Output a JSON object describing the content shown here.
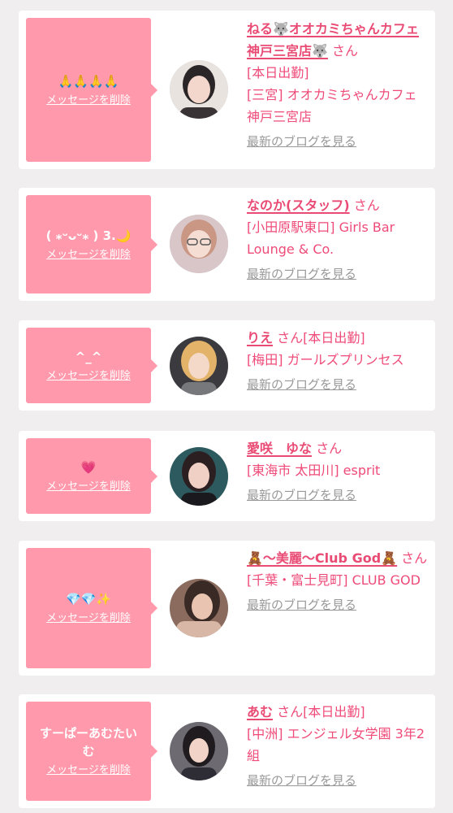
{
  "colors": {
    "page_bg": "#f1eeef",
    "card_bg": "#ffffff",
    "bubble_bg": "#ff99ab",
    "accent_pink": "#e94b74",
    "link_gray": "#999999"
  },
  "entries": [
    {
      "message": "🙏🙏🙏🙏",
      "delete_label": "メッセージを削除",
      "name": "ねる🐺オオカミちゃんカフェ神戸三宮店🐺",
      "honorific": " さん",
      "status": "[本日出勤]",
      "location": "[三宮] オオカミちゃんカフェ神戸三宮店",
      "blog_label": "最新のブログを見る",
      "avatar_icon": "profile-photo"
    },
    {
      "message": "( ⁎ᵕᴗᵕ⁎ ) 3.🌙",
      "delete_label": "メッセージを削除",
      "name": "なのか(スタッフ)",
      "honorific": " さん",
      "status": "",
      "location": "[小田原駅東口] Girls Bar Lounge & Co.",
      "blog_label": "最新のブログを見る",
      "avatar_icon": "profile-photo"
    },
    {
      "message": "^_^",
      "delete_label": "メッセージを削除",
      "name": "りえ",
      "honorific": " さん[本日出勤]",
      "status": "",
      "location": "[梅田] ガールズプリンセス",
      "blog_label": "最新のブログを見る",
      "avatar_icon": "profile-photo"
    },
    {
      "message": "💗",
      "delete_label": "メッセージを削除",
      "name": "愛咲　ゆな",
      "honorific": " さん",
      "status": "",
      "location": "[東海市 太田川] esprit",
      "blog_label": "",
      "avatar_icon": "profile-photo"
    },
    {
      "message": "💎💎✨",
      "delete_label": "メッセージを削除",
      "name": "🧸〜美麗〜Club God🧸",
      "honorific": " さん",
      "status": "",
      "location": "[千葉・富士見町] CLUB GOD",
      "blog_label": "最新のブログを見る",
      "avatar_icon": "profile-photo"
    },
    {
      "message": "すーぱーあむたいむ",
      "delete_label": "メッセージを削除",
      "name": "あむ",
      "honorific": " さん[本日出勤]",
      "status": "",
      "location": "[中洲] エンジェル女学園 3年2組",
      "blog_label": "最新のブログを見る",
      "avatar_icon": "profile-photo"
    }
  ]
}
